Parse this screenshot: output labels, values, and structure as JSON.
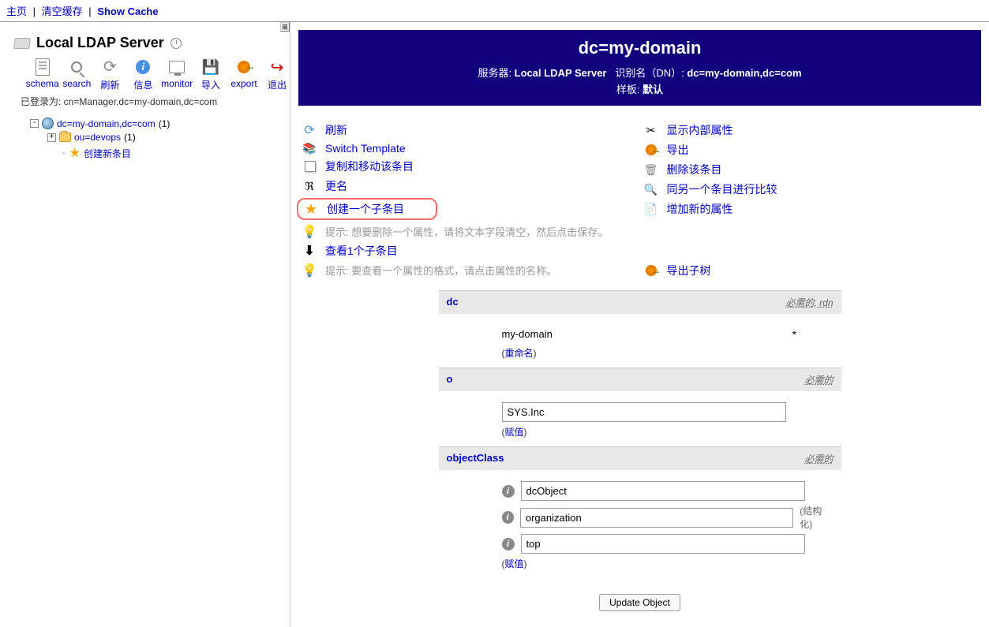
{
  "nav": {
    "home": "主页",
    "clear_cache": "清空缓存",
    "show_cache": "Show Cache"
  },
  "server": {
    "name": "Local LDAP Server",
    "login_prefix": "已登录为: ",
    "login_dn": "cn=Manager,dc=my-domain,dc=com"
  },
  "toolbar": {
    "schema": "schema",
    "search": "search",
    "refresh": "刷新",
    "info": "信息",
    "monitor": "monitor",
    "import": "导入",
    "export": "export",
    "logout": "退出"
  },
  "tree": {
    "root": "dc=my-domain,dc=com",
    "root_count": "(1)",
    "child1": "ou=devops",
    "child1_count": "(1)",
    "create": "创建新条目"
  },
  "entry": {
    "title": "dc=my-domain",
    "server_label": "服务器: ",
    "server_value": "Local LDAP Server",
    "dn_label": "识别名（DN）: ",
    "dn_value": "dc=my-domain,dc=com",
    "template_label": "样板: ",
    "template_value": "默认"
  },
  "actions_left": {
    "refresh": "刷新",
    "switch_template": "Switch Template",
    "copy_move": "复制和移动该条目",
    "rename": "更名",
    "create_child": "创建一个子条目",
    "hint1": "提示:   想要删除一个属性，请将文本字段清空，然后点击保存。",
    "view_children": "查看1个子条目",
    "hint2": "提示:   要查看一个属性的格式，请点击属性的名称。"
  },
  "actions_right": {
    "show_internal": "显示内部属性",
    "export": "导出",
    "delete": "删除该条目",
    "compare": "同另一个条目进行比较",
    "add_attr": "增加新的属性",
    "export_subtree": "导出子树"
  },
  "attrs": {
    "dc": {
      "name": "dc",
      "req": "必需的, rdn",
      "value": "my-domain",
      "action": "重命名"
    },
    "o": {
      "name": "o",
      "req": "必需的",
      "value": "SYS.Inc",
      "action": "赋值"
    },
    "objectClass": {
      "name": "objectClass",
      "req": "必需的",
      "values": [
        "dcObject",
        "organization",
        "top"
      ],
      "structural": "结构化",
      "action": "赋值"
    }
  },
  "update_button": "Update Object"
}
